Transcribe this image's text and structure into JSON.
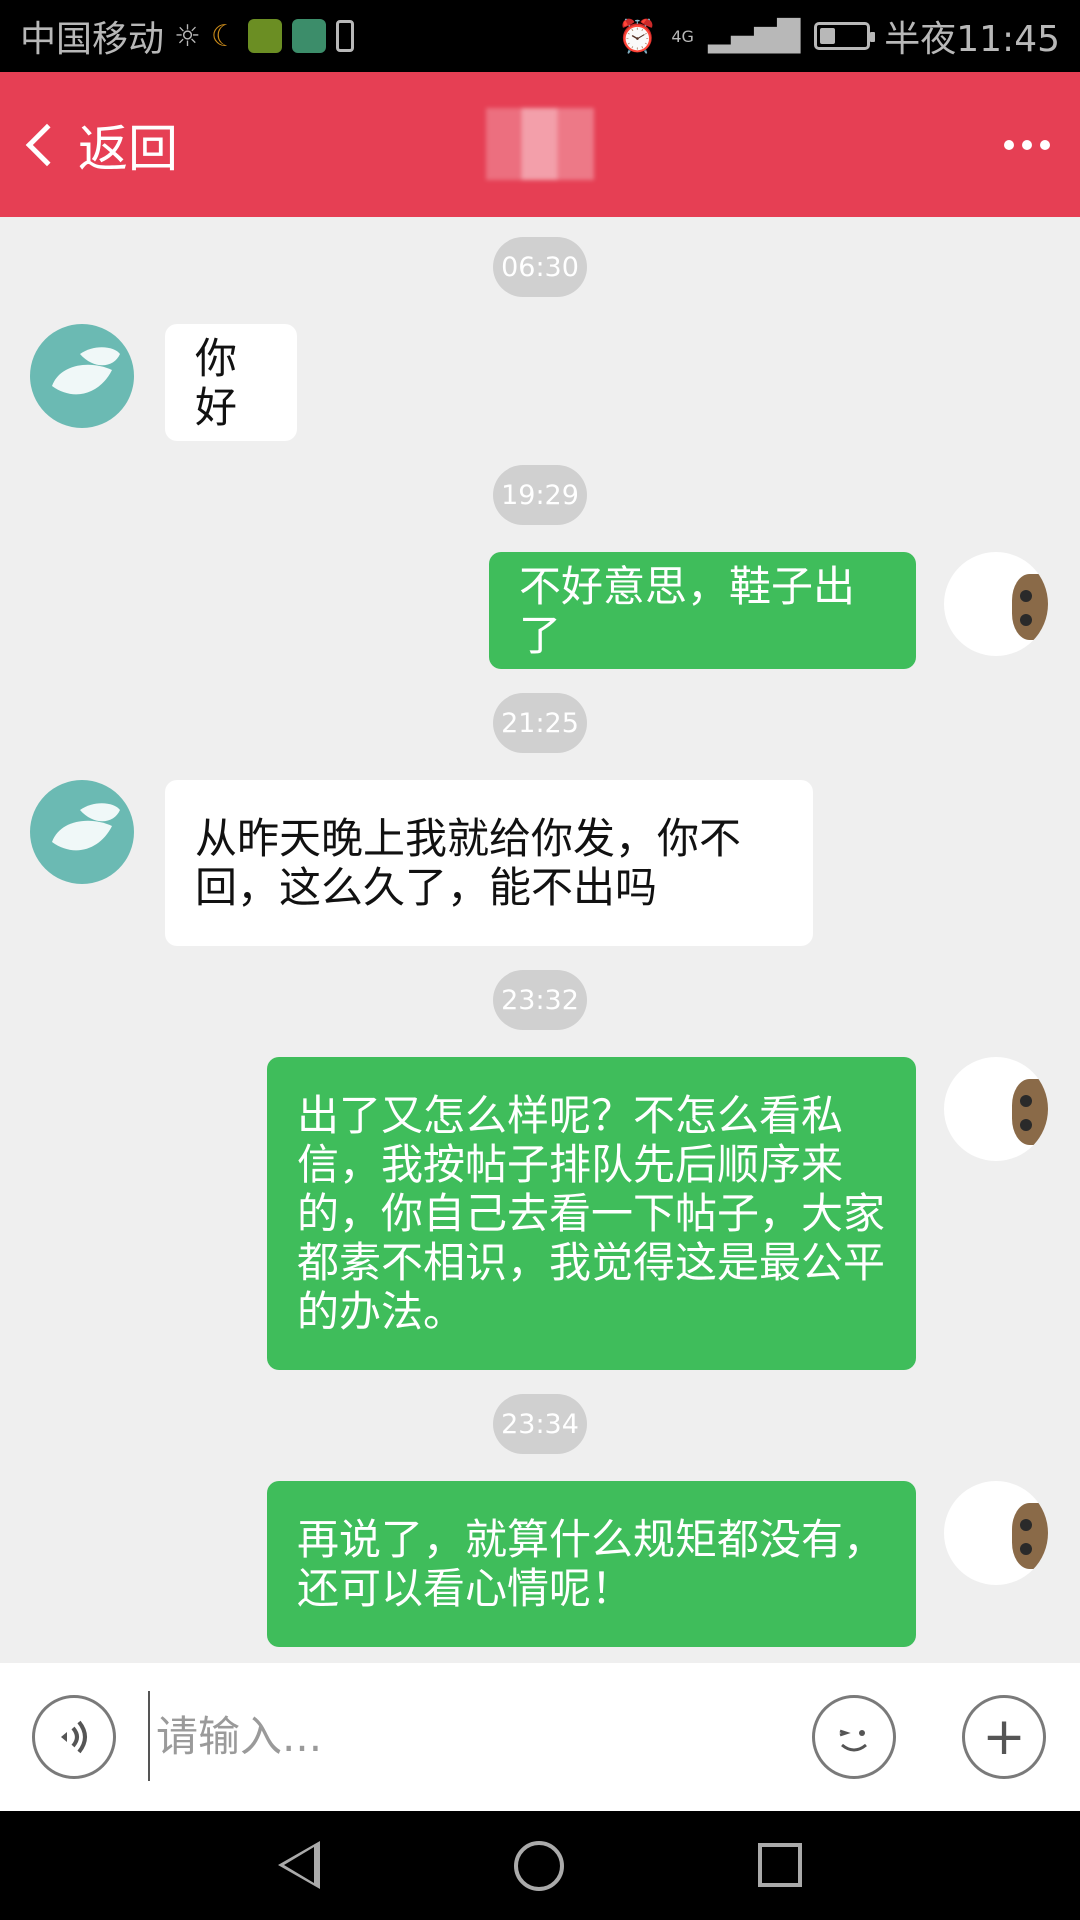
{
  "status_bar": {
    "carrier": "中国移动",
    "network": "4G",
    "time": "半夜11:45",
    "battery_level": 0.35,
    "icons": [
      "brightness-icon",
      "moon-icon",
      "app-icon-1",
      "app-icon-2",
      "clipboard-icon",
      "alarm-icon",
      "signal-icon",
      "battery-icon"
    ]
  },
  "header": {
    "back_label": "返回",
    "title": "",
    "more_icon": "more-icon",
    "background": "#e63f54"
  },
  "messages": [
    {
      "timestamp": "06:30"
    },
    {
      "direction": "in",
      "text": "你好"
    },
    {
      "timestamp": "19:29"
    },
    {
      "direction": "out",
      "text": "不好意思，鞋子出了"
    },
    {
      "timestamp": "21:25"
    },
    {
      "direction": "in",
      "lines": [
        "从昨天晚上我就给你发，你不",
        "回，这么久了，能不出吗"
      ]
    },
    {
      "timestamp": "23:32"
    },
    {
      "direction": "out",
      "lines": [
        "出了又怎么样呢？不怎么看私",
        "信，我按帖子排队先后顺序来",
        "的，你自己去看一下帖子，大家",
        "都素不相识，我觉得这是最公平",
        "的办法。"
      ]
    },
    {
      "timestamp": "23:34"
    },
    {
      "direction": "out",
      "lines": [
        "再说了，就算什么规矩都没有，",
        "还可以看心情呢！"
      ]
    }
  ],
  "input_bar": {
    "placeholder": "请输入...",
    "value": "",
    "voice_icon": "voice-icon",
    "emoji_icon": "emoji-icon",
    "plus_icon": "plus-icon",
    "plus_symbol": "+"
  },
  "nav_bar": {
    "icons": [
      "back-triangle-icon",
      "home-circle-icon",
      "recent-square-icon"
    ]
  },
  "colors": {
    "accent": "#e63f54",
    "outgoing_bubble": "#3fbd5b",
    "incoming_bubble": "#ffffff",
    "chat_background": "#efefef",
    "timestamp_pill": "#d0d0d0"
  }
}
